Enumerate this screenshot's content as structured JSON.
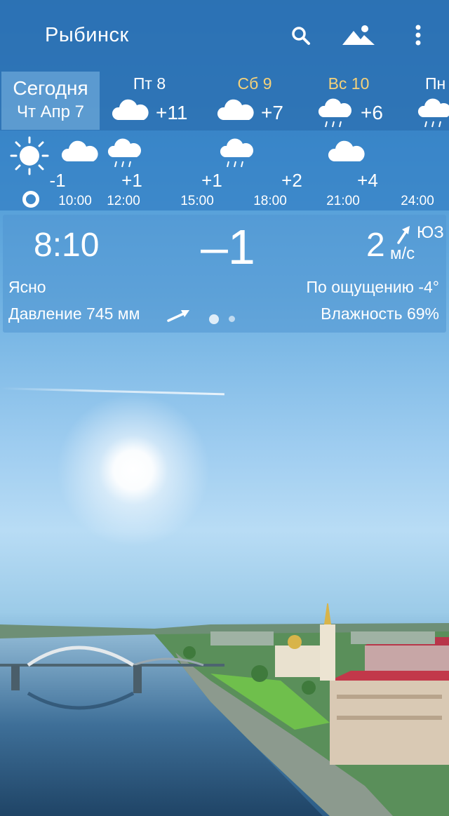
{
  "app": {
    "city": "Рыбинск"
  },
  "days": {
    "today": {
      "label": "Сегодня",
      "date": "Чт Апр 7"
    },
    "items": [
      {
        "name": "Пт 8",
        "temp": "+11",
        "icon": "cloud-icon",
        "weekend": false
      },
      {
        "name": "Сб 9",
        "temp": "+7",
        "icon": "cloud-icon",
        "weekend": true
      },
      {
        "name": "Вс 10",
        "temp": "+6",
        "icon": "rain-cloud-icon",
        "weekend": true
      },
      {
        "name": "Пн",
        "temp": "",
        "icon": "rain-cloud-icon",
        "weekend": false
      }
    ]
  },
  "hours": {
    "items": [
      {
        "time": "10:00",
        "temp": "-1",
        "icon": "sun-icon"
      },
      {
        "time": "12:00",
        "temp": "+1",
        "icon": "cloud-icon"
      },
      {
        "time": "15:00",
        "temp": "+1",
        "icon": "rain-cloud-icon"
      },
      {
        "time": "18:00",
        "temp": "+2",
        "icon": "none"
      },
      {
        "time": "21:00",
        "temp": "+4",
        "icon": "rain-cloud-icon"
      },
      {
        "time": "24:00",
        "temp": "",
        "icon": "cloud-icon"
      }
    ]
  },
  "current": {
    "time": "8:10",
    "temp": "–1",
    "wind_speed": "2",
    "wind_unit": "м/с",
    "wind_dir": "ЮЗ",
    "condition": "Ясно",
    "feels_like": "По ощущению -4°",
    "pressure": "Давление 745 мм",
    "humidity": "Влажность 69%"
  },
  "colors": {
    "weekend": "#f5d27a",
    "bar": "#2c70b2"
  }
}
